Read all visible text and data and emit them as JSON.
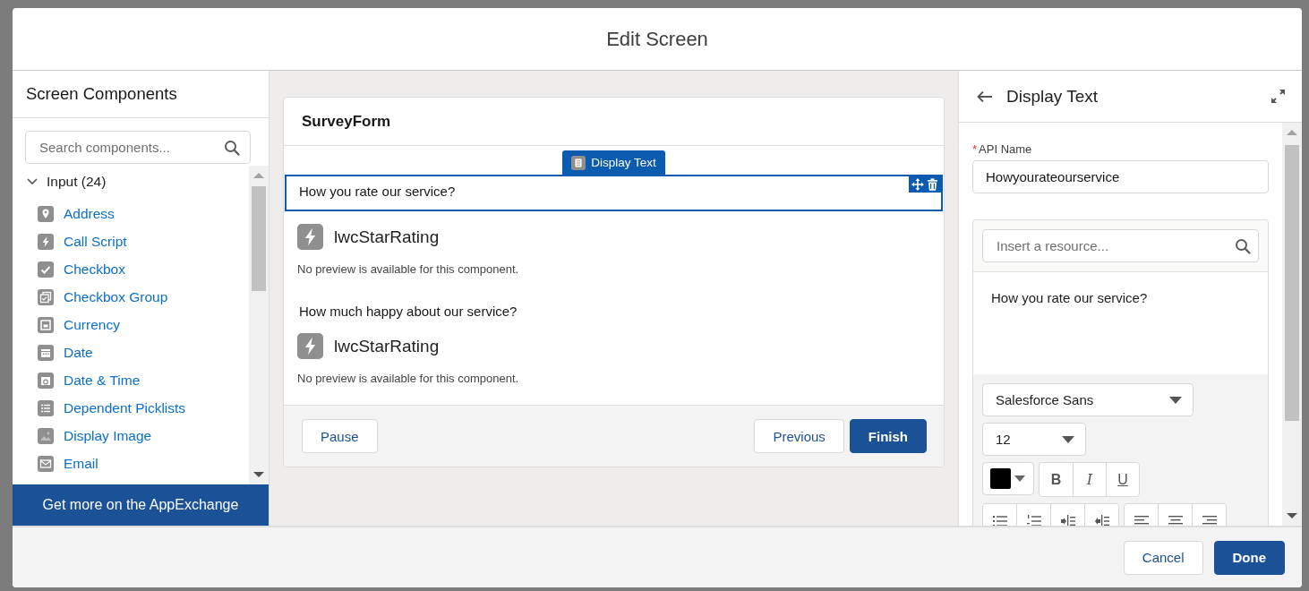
{
  "modal": {
    "title": "Edit Screen"
  },
  "palette": {
    "title": "Screen Components",
    "search": {
      "placeholder": "Search components..."
    },
    "section": {
      "label": "Input (24)",
      "expanded": true
    },
    "items": [
      {
        "label": "Address"
      },
      {
        "label": "Call Script"
      },
      {
        "label": "Checkbox"
      },
      {
        "label": "Checkbox Group"
      },
      {
        "label": "Currency"
      },
      {
        "label": "Date"
      },
      {
        "label": "Date & Time"
      },
      {
        "label": "Dependent Picklists"
      },
      {
        "label": "Display Image"
      },
      {
        "label": "Email"
      }
    ],
    "appexchange_button": "Get more on the AppExchange"
  },
  "canvas": {
    "screen_title": "SurveyForm",
    "fields": [
      {
        "kind": "text",
        "text": "How you rate our service?",
        "selected": true,
        "tag": "Display Text"
      },
      {
        "kind": "component",
        "name": "lwcStarRating",
        "note": "No preview is available for this component.",
        "selected": false
      },
      {
        "kind": "text",
        "text": "How much happy about our service?",
        "selected": false
      },
      {
        "kind": "component",
        "name": "lwcStarRating",
        "note": "No preview is available for this component.",
        "selected": false
      }
    ],
    "buttons": [
      {
        "label": "Pause",
        "kind": "neutral"
      },
      {
        "label": "Previous",
        "kind": "neutral"
      },
      {
        "label": "Finish",
        "kind": "brand"
      }
    ]
  },
  "properties": {
    "title": "Display Text",
    "api_name": {
      "required_mark": "*",
      "label": "API Name",
      "value": "Howyourateourservice"
    },
    "resource_search": {
      "placeholder": "Insert a resource..."
    },
    "editor_text": "How you rate our service?",
    "font_family": "Salesforce Sans",
    "font_size": "12",
    "format_buttons": [
      "B",
      "I",
      "U"
    ]
  },
  "footer": {
    "buttons": [
      {
        "label": "Cancel",
        "kind": "neutral"
      },
      {
        "label": "Done",
        "kind": "brand"
      }
    ]
  }
}
